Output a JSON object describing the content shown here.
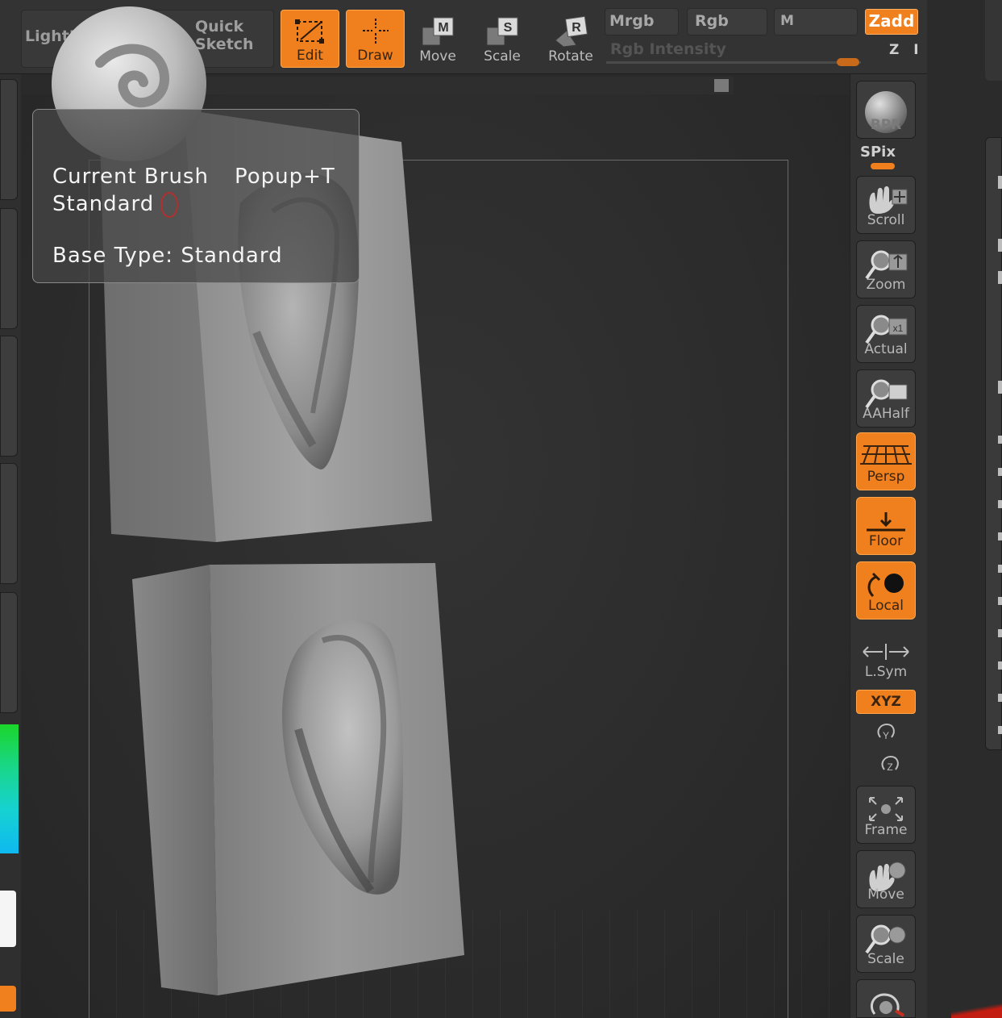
{
  "toolbar": {
    "lightbox_label": "LightBox",
    "quick_sketch_label": "Quick\nSketch",
    "edit_label": "Edit",
    "draw_label": "Draw",
    "move_label": "Move",
    "scale_label": "Scale",
    "rotate_label": "Rotate",
    "mrgb_label": "Mrgb",
    "rgb_label": "Rgb",
    "m_label": "M",
    "zadd_label": "Zadd",
    "zsub_label": "Z I",
    "rgb_intensity_label": "Rgb Intensity",
    "move_key": "M",
    "scale_key": "S",
    "rotate_key": "R"
  },
  "brush_popup": {
    "title": "Current Brush",
    "shortcut": "Popup+T",
    "brush_name": "Standard",
    "base_type": "Base Type: Standard"
  },
  "right_shelf": {
    "bpr_label": "BPR",
    "spix_label": "SPix",
    "scroll_label": "Scroll",
    "zoom_label": "Zoom",
    "actual_label": "Actual",
    "aahalf_label": "AAHalf",
    "persp_label": "Persp",
    "floor_label": "Floor",
    "local_label": "Local",
    "lsym_label": "L.Sym",
    "xyz_label": "XYZ",
    "frame_label": "Frame",
    "move_label": "Move",
    "scale_label": "Scale"
  },
  "colors": {
    "accent": "#f07f1d",
    "panel": "#333333",
    "canvas": "#2a2a2a"
  }
}
